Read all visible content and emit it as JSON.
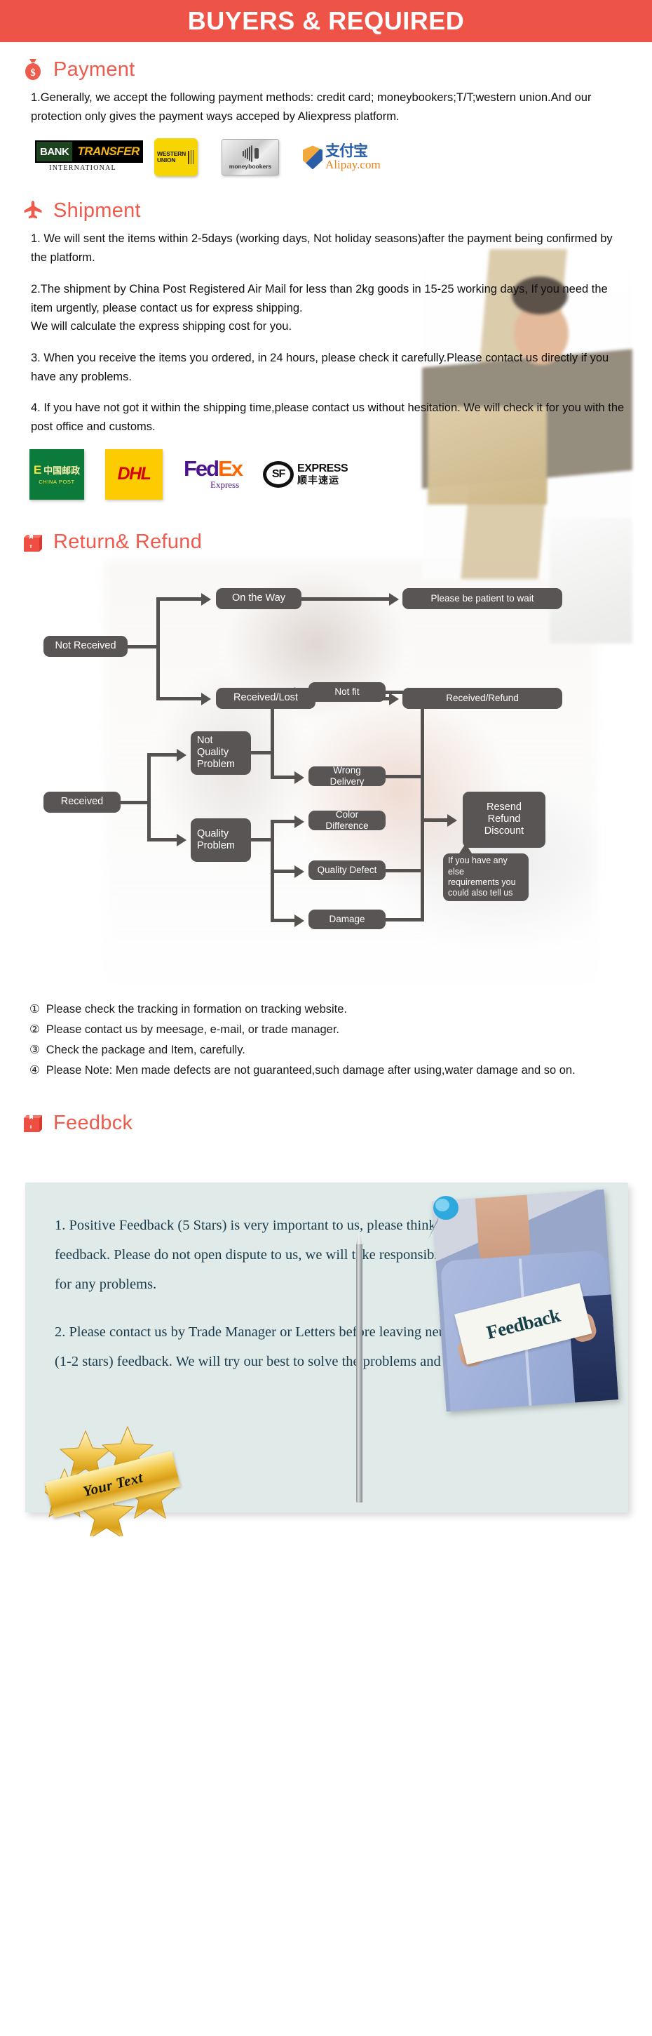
{
  "banner": {
    "title": "BUYERS & REQUIRED",
    "bg_color": "#ee5347",
    "text_color": "#ffffff"
  },
  "accent_color": "#ee5a4c",
  "sections": {
    "payment": {
      "icon": "money-bag-icon",
      "heading": "Payment",
      "paragraphs": [
        "1.Generally, we accept the following payment methods: credit card; moneybookers;T/T;western union.And our protection only gives the payment ways acceped by Aliexpress platform."
      ],
      "logos": [
        {
          "name": "bank-transfer-logo",
          "line1": "BANK",
          "line2": "TRANSFER",
          "line3": "INTERNATIONAL"
        },
        {
          "name": "western-union-logo",
          "line1": "WESTERN",
          "line2": "UNION"
        },
        {
          "name": "moneybookers-logo",
          "line1": "moneybookers"
        },
        {
          "name": "alipay-logo",
          "line1": "支付宝",
          "line2": "Alipay.com"
        }
      ]
    },
    "shipment": {
      "icon": "airplane-icon",
      "heading": "Shipment",
      "paragraphs": [
        "1. We will sent the items within 2-5days (working days, Not holiday seasons)after the payment being confirmed by the platform.",
        "2.The shipment by China Post Registered Air Mail for less than  2kg goods in 15-25 working days, If  you need the item urgently, please contact us for express shipping.",
        "We will calculate the express shipping cost for you.",
        "3. When you receive the items you ordered, in 24 hours, please check  it carefully.Please contact us directly if you have any problems.",
        "4. If you have not got it within the shipping time,please contact us without hesitation. We will check it for you with the post office and customs."
      ],
      "logos": [
        {
          "name": "china-post-logo",
          "line1": "中国邮政",
          "line2": "CHINA POST"
        },
        {
          "name": "dhl-logo",
          "line1": "DHL"
        },
        {
          "name": "fedex-logo",
          "line1": "Fed",
          "line2": "Ex",
          "line3": "Express"
        },
        {
          "name": "sf-express-logo",
          "line1": "SF",
          "line2": "EXPRESS",
          "line3": "顺丰速运"
        }
      ]
    },
    "return_refund": {
      "icon": "open-box-icon",
      "heading": "Return& Refund",
      "flow_nodes": [
        {
          "id": "not-received",
          "label": "Not Received"
        },
        {
          "id": "on-the-way",
          "label": "On the Way"
        },
        {
          "id": "please-be-patient",
          "label": "Please be patient to wait"
        },
        {
          "id": "received-lost",
          "label": "Received/Lost"
        },
        {
          "id": "received-refund",
          "label": "Received/Refund"
        },
        {
          "id": "received",
          "label": "Received"
        },
        {
          "id": "not-quality-problem",
          "label": "Not\nQuality\nProblem"
        },
        {
          "id": "quality-problem",
          "label": "Quality\nProblem"
        },
        {
          "id": "not-fit",
          "label": "Not fit"
        },
        {
          "id": "wrong-delivery",
          "label": "Wrong Delivery"
        },
        {
          "id": "color-difference",
          "label": "Color Difference"
        },
        {
          "id": "quality-defect",
          "label": "Quality Defect"
        },
        {
          "id": "damage",
          "label": "Damage"
        },
        {
          "id": "resend-refund-discount",
          "label": "Resend\nRefund\nDiscount"
        },
        {
          "id": "else-requirements",
          "label": "If you have any else\nrequirements you\ncould also tell us"
        }
      ],
      "notes": [
        {
          "marker": "①",
          "text": "Please check the tracking in formation on tracking website."
        },
        {
          "marker": "②",
          "text": "Please contact us by meesage, e-mail, or trade manager."
        },
        {
          "marker": "③",
          "text": "Check the package and Item, carefully."
        },
        {
          "marker": "④",
          "text": "Please Note: Men made defects  are not guaranteed,such damage after using,water damage and so on."
        }
      ]
    },
    "feedback": {
      "icon": "open-box-icon",
      "heading": "Feedbck",
      "photo_caption": "Feedback",
      "panel_bg_color": "#dfeae9",
      "paragraphs": [
        "1. Positive Feedback (5 Stars) is very important to us, please think twice before leaving feedback. Please do not open dispute to us,   we will take responsibility to resend or refund for any problems.",
        "2. Please contact us by Trade Manager or Letters before leaving neutral(3 stars) or negative (1-2 stars) feedback. We will try our best to solve the problems and please trust us"
      ],
      "badge_text": "Your Text"
    }
  }
}
